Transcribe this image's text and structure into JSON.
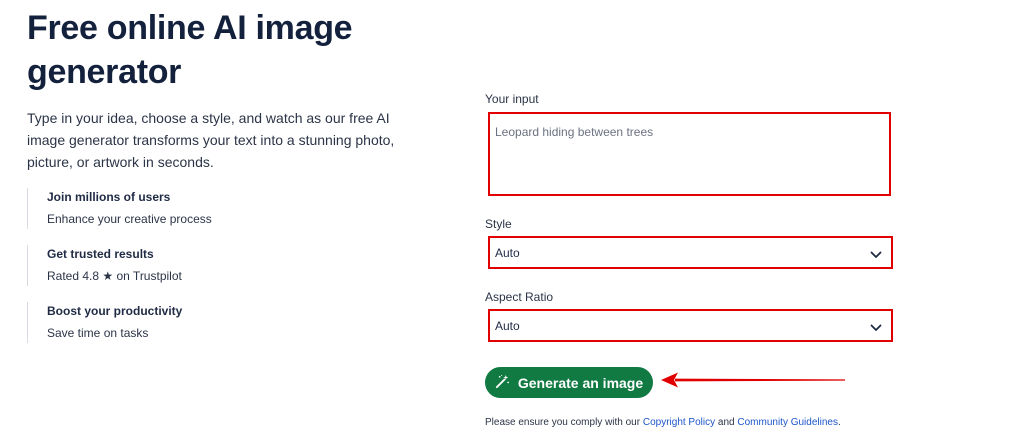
{
  "hero": {
    "title": "Free online AI image generator",
    "description": "Type in your idea, choose a style, and watch as our free AI image generator transforms your text into a stunning photo, picture, or artwork in seconds."
  },
  "features": [
    {
      "title": "Join millions of users",
      "desc": "Enhance your creative process"
    },
    {
      "title": "Get trusted results",
      "desc": "Rated 4.8 ★ on Trustpilot"
    },
    {
      "title": "Boost your productivity",
      "desc": "Save time on tasks"
    }
  ],
  "form": {
    "input_label": "Your input",
    "input_placeholder": "Leopard hiding between trees",
    "style_label": "Style",
    "style_value": "Auto",
    "aspect_label": "Aspect Ratio",
    "aspect_value": "Auto",
    "generate_label": "Generate an image",
    "generate_icon": "magic-wand-icon"
  },
  "compliance": {
    "prefix": "Please ensure you comply with our",
    "copyright_link": "Copyright Policy",
    "and": "and",
    "guidelines_link": "Community Guidelines",
    "suffix": "."
  },
  "colors": {
    "highlight_border": "#e00000",
    "button_green": "#117a43",
    "link_blue": "#1d56c9",
    "arrow_red": "#e00000"
  }
}
